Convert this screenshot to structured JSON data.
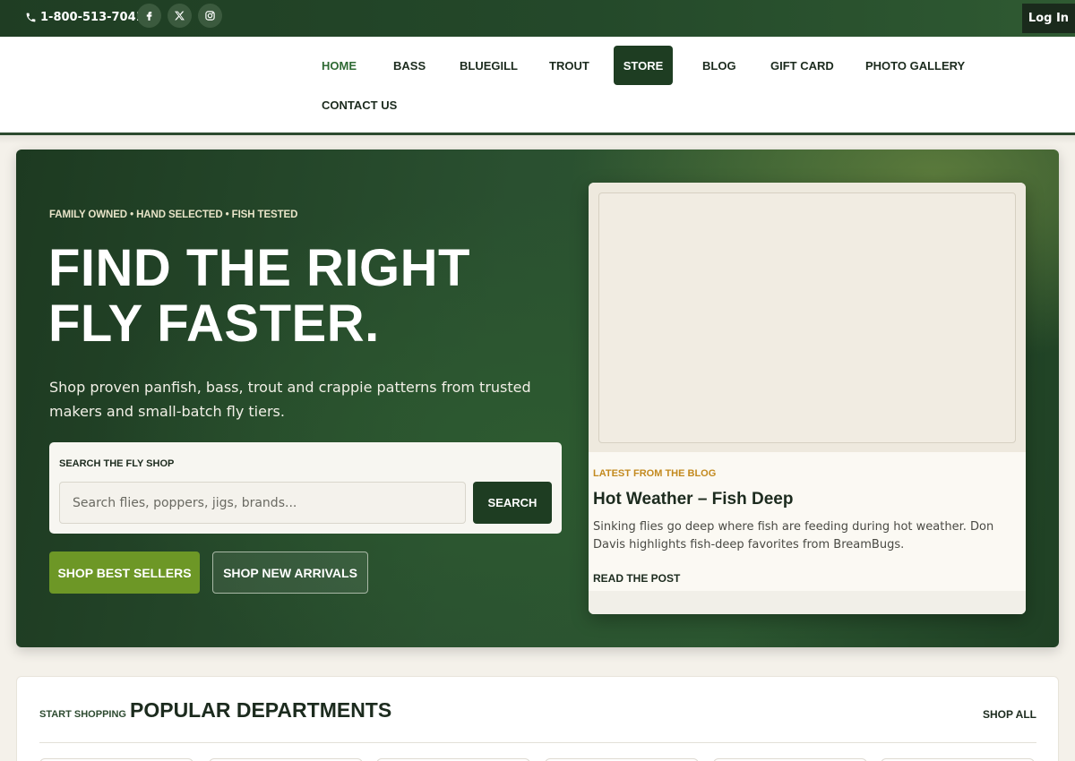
{
  "topbar": {
    "phone": "1-800-513-7041",
    "social": [
      {
        "icon": "facebook-icon"
      },
      {
        "icon": "x-twitter-icon"
      },
      {
        "icon": "instagram-icon"
      }
    ],
    "login_label": "Log In"
  },
  "nav": {
    "items": [
      {
        "label": "HOME"
      },
      {
        "label": "BASS"
      },
      {
        "label": "BLUEGILL"
      },
      {
        "label": "TROUT"
      },
      {
        "label": "STORE"
      },
      {
        "label": "BLOG"
      },
      {
        "label": "GIFT CARD"
      },
      {
        "label": "PHOTO GALLERY"
      },
      {
        "label": "CONTACT US"
      }
    ]
  },
  "hero": {
    "eyebrow": "FAMILY OWNED • HAND SELECTED • FISH TESTED",
    "headline": "FIND THE RIGHT FLY FASTER.",
    "subtext": "Shop proven panfish, bass, trout and crappie patterns from trusted makers and small-batch fly tiers.",
    "search": {
      "label": "SEARCH THE FLY SHOP",
      "placeholder": "Search flies, poppers, jigs, brands...",
      "button": "SEARCH"
    },
    "btn_best_sellers": "SHOP BEST SELLERS",
    "btn_new_arrivals": "SHOP NEW ARRIVALS"
  },
  "blog": {
    "eyebrow": "LATEST FROM THE BLOG",
    "title": "Hot Weather – Fish Deep",
    "excerpt": "Sinking flies go deep where fish are feeding during hot weather. Don Davis highlights fish-deep favorites from BreamBugs.",
    "read_more": "READ THE POST"
  },
  "departments": {
    "eyebrow": "START SHOPPING",
    "title": "POPULAR DEPARTMENTS",
    "shop_all": "SHOP ALL"
  },
  "colors": {
    "brand_dark_green": "#1e3d22",
    "accent_olive": "#6d9726",
    "blog_eyebrow_gold": "#c38a1f",
    "page_bg": "#f4f1ea"
  }
}
